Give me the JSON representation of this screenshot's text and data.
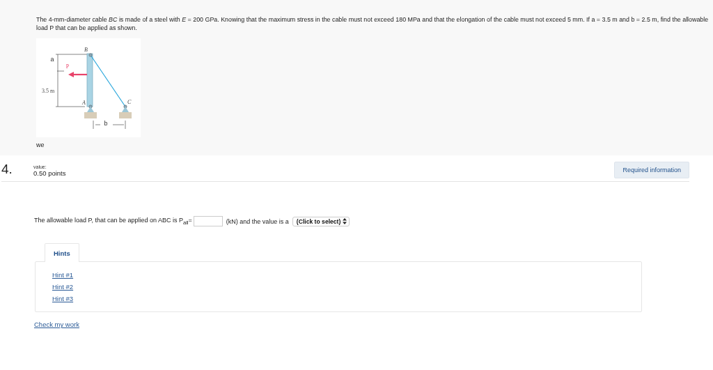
{
  "problem": {
    "text": "The 4-mm-diameter cable *BC* is made of a steel with *E* = 200 GPa. Knowing that the maximum stress in the cable must not exceed 180 MPa and that the elongation of the cable must not exceed 5 mm. If a = 3.5 m and b = 2.5 m, find the allowable  load P that can be applied as shown.",
    "figure": {
      "labels": [
        "B",
        "a",
        "P",
        "3.5 m",
        "A",
        "C",
        "b"
      ]
    },
    "note": "we"
  },
  "question": {
    "number": "4.",
    "value_label": "value:",
    "points": "0.50 points",
    "required_button": "Required information"
  },
  "answer": {
    "before": "The allowable load P, that can be applied on ABC is P$_{all}$=",
    "after": "(kN) and the value is a",
    "select": "(Click to select)"
  },
  "hints": {
    "tab": "Hints",
    "tab_selected": true,
    "links": [
      "Hint #1",
      "Hint #2",
      "Hint #3"
    ]
  },
  "check_link": "Check my work"
}
